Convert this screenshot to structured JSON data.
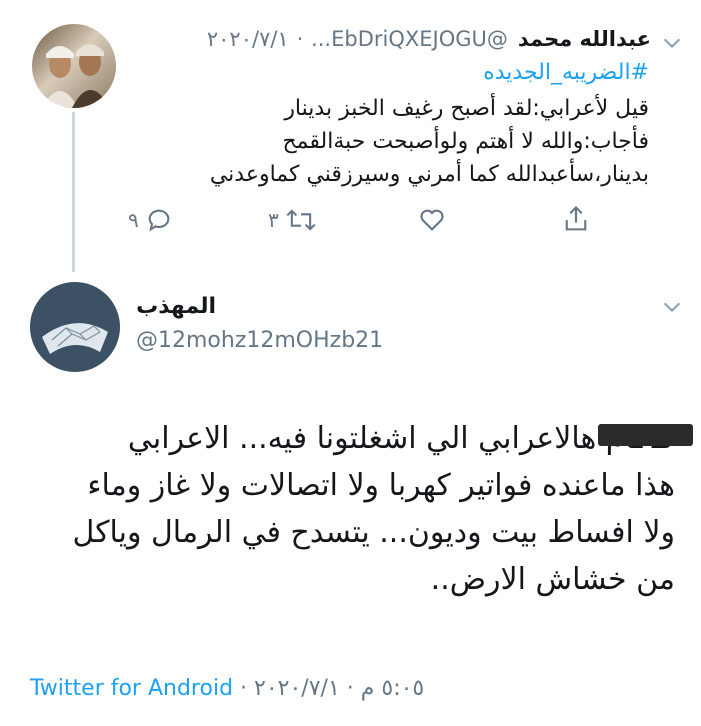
{
  "tweet1": {
    "name": "عبدالله محمد",
    "handle": "@EbDriQXEJOGU...",
    "date": "٢٠٢٠/٧/١",
    "hashtag": "#الضريبه_الجديده",
    "lines": [
      "قيل لأعرابي:لقد أصبح رغيف الخبز بدينار",
      "فأجاب:والله لا أهتم ولوأصبحت حبةالقمح",
      "بدينار،سأعبدالله كما أمرني وسيرزقني كماوعدني"
    ],
    "actions": {
      "reply_count": "٩",
      "retweet_count": "٣"
    }
  },
  "tweet2": {
    "name": "المهذب",
    "handle": "@12mohz12mOHzb21",
    "lines": [
      "كـ ـام هالاعرابي الي اشغلتونا فيه... الاعرابي",
      "هذا ماعنده فواتير كهربا ولا اتصالات ولا غاز وماء",
      "ولا افساط بيت وديون... يتسدح في الرمال وياكل",
      "من خشاش الارض.."
    ],
    "footer": {
      "time": "٥:٠٥ م",
      "date": "٢٠٢٠/٧/١",
      "source": "Twitter for Android"
    }
  },
  "colors": {
    "accent": "#1da1f2",
    "secondary_text": "#657786",
    "primary_text": "#14171a",
    "thread_line": "#ccd6dd"
  },
  "icons": [
    "chevron-down-icon",
    "reply-icon",
    "retweet-icon",
    "like-icon",
    "share-icon"
  ]
}
